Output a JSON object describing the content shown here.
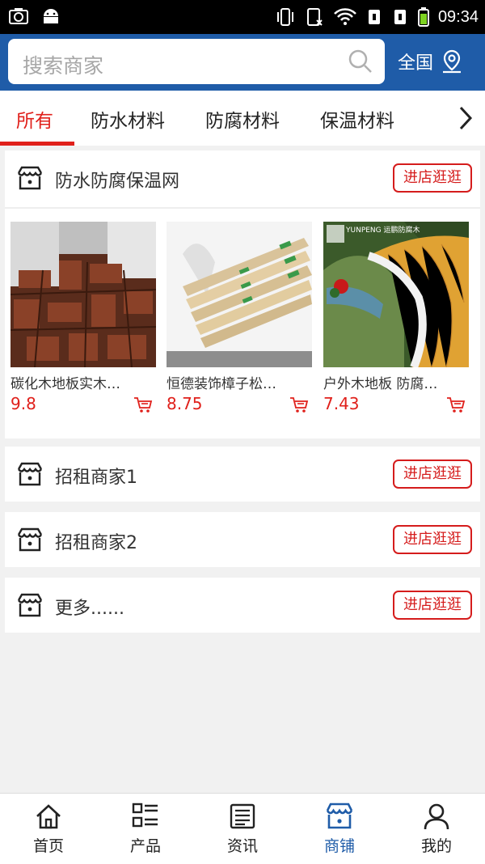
{
  "status_bar": {
    "time": "09:34"
  },
  "header": {
    "search_placeholder": "搜索商家",
    "region_label": "全国"
  },
  "tabs": [
    {
      "label": "所有",
      "active": true
    },
    {
      "label": "防水材料",
      "active": false
    },
    {
      "label": "防腐材料",
      "active": false
    },
    {
      "label": "保温材料",
      "active": false
    }
  ],
  "shops": [
    {
      "name": "防水防腐保温网",
      "button": "进店逛逛",
      "products": [
        {
          "name": "碳化木地板实木…",
          "price": "9.8"
        },
        {
          "name": "恒德装饰樟子松…",
          "price": "8.75"
        },
        {
          "name": "户外木地板 防腐…",
          "price": "7.43",
          "image_text": "YUNPENG 运鹏防腐木"
        }
      ]
    },
    {
      "name": "招租商家1",
      "button": "进店逛逛"
    },
    {
      "name": "招租商家2",
      "button": "进店逛逛"
    },
    {
      "name": "更多......",
      "button": "进店逛逛"
    }
  ],
  "bottom_nav": [
    {
      "label": "首页",
      "icon": "home-icon",
      "active": false
    },
    {
      "label": "产品",
      "icon": "list-icon",
      "active": false
    },
    {
      "label": "资讯",
      "icon": "news-icon",
      "active": false
    },
    {
      "label": "商铺",
      "icon": "store-icon",
      "active": true
    },
    {
      "label": "我的",
      "icon": "user-icon",
      "active": false
    }
  ],
  "colors": {
    "brand_blue": "#1f5ca8",
    "accent_red": "#e0201b"
  }
}
